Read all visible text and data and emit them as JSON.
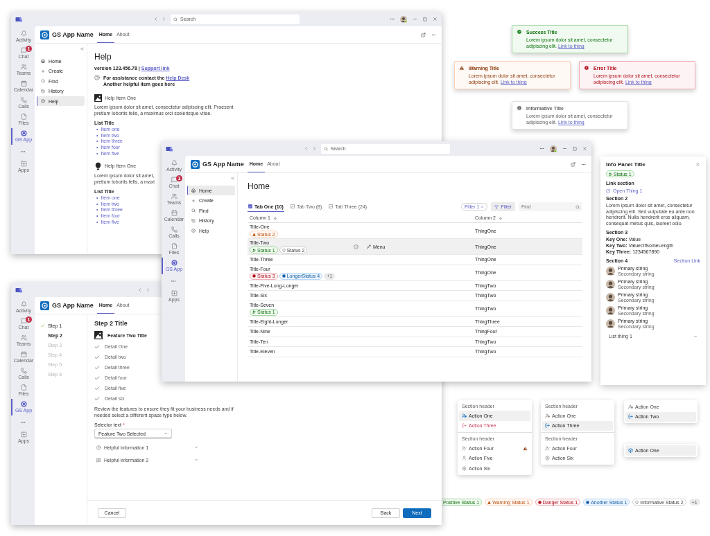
{
  "help_window": {
    "title_bar": {
      "search_placeholder": "Search"
    },
    "rail": [
      {
        "kind": "app",
        "label": "Activity",
        "selected": false
      },
      {
        "kind": "app",
        "label": "Chat",
        "selected": false,
        "badge": "1"
      },
      {
        "kind": "app",
        "label": "Teams",
        "selected": false
      },
      {
        "kind": "app",
        "label": "Calendar",
        "selected": false
      },
      {
        "kind": "app",
        "label": "Calls",
        "selected": false
      },
      {
        "kind": "app",
        "label": "Files",
        "selected": false
      },
      {
        "kind": "app",
        "label": "GS App",
        "selected": true
      },
      {
        "kind": "more"
      },
      {
        "kind": "app",
        "label": "Apps",
        "selected": false
      }
    ],
    "app_name": "GS App Name",
    "tabs": [
      {
        "label": "Home",
        "selected": true
      },
      {
        "label": "About",
        "selected": false
      }
    ],
    "nav": [
      {
        "label": "Home",
        "selected": false
      },
      {
        "label": "Create",
        "selected": false
      },
      {
        "label": "Find",
        "selected": false
      },
      {
        "label": "History",
        "selected": false
      },
      {
        "label": "Help",
        "selected": true
      }
    ],
    "page_title": "Help",
    "version": "version 123.456.78 | ",
    "support_link": "Support link",
    "assistance": "For assistance contact the ",
    "help_desk_link": "Help Desk",
    "assistance_note": "Another helpful item goes here",
    "help_items": [
      {
        "title": "Help Item One",
        "lines": [
          "Lorem ipsum dolor sit amet, consectetur adipiscing elit. Praesent",
          "pretium lobortis felis, a maximus orci scelerisque vitae."
        ],
        "list_title": "List Title",
        "marker": "•",
        "list": [
          "Item one",
          "Item two",
          "Item three",
          "Item four",
          "Item five"
        ]
      },
      {
        "title": "Help Item One",
        "lines": [
          "Lorem ipsum dolor sit amet,",
          "pretium lobortis felis, a maxi"
        ],
        "list_title": "List Title",
        "marker": "•",
        "list": [
          "Item one",
          "Item two",
          "Item three",
          "Item four",
          "Item five"
        ]
      }
    ]
  },
  "home_window": {
    "title_bar": {
      "search_placeholder": "Search"
    },
    "rail": [
      {
        "kind": "app",
        "label": "Activity",
        "selected": false
      },
      {
        "kind": "app",
        "label": "Chat",
        "selected": false,
        "badge": "1"
      },
      {
        "kind": "app",
        "label": "Teams",
        "selected": false
      },
      {
        "kind": "app",
        "label": "Calendar",
        "selected": false
      },
      {
        "kind": "app",
        "label": "Calls",
        "selected": false
      },
      {
        "kind": "app",
        "label": "Files",
        "selected": false
      },
      {
        "kind": "app",
        "label": "GS App",
        "selected": true
      },
      {
        "kind": "more"
      },
      {
        "kind": "app",
        "label": "Apps",
        "selected": false
      }
    ],
    "app_name": "GS App Name",
    "tabs": [
      {
        "label": "Home",
        "selected": true
      },
      {
        "label": "About",
        "selected": false
      }
    ],
    "nav": [
      {
        "label": "Home",
        "selected": true
      },
      {
        "label": "Create",
        "selected": false
      },
      {
        "label": "Find",
        "selected": false
      },
      {
        "label": "History",
        "selected": false
      },
      {
        "label": "Help",
        "selected": false
      }
    ],
    "page_title": "Home",
    "view_tabs": [
      {
        "label": "Tab One (10)",
        "selected": true
      },
      {
        "label": "Tab Two (8)",
        "selected": false
      },
      {
        "label": "Tab Three (24)",
        "selected": false
      }
    ],
    "filter_chip": "Filter 1",
    "filter_button": "Filter",
    "find_placeholder": "Find",
    "columns": [
      "Column 1",
      "Column 2"
    ],
    "rows": [
      {
        "title": "Title-One",
        "badges": [
          {
            "kind": "warning",
            "label": "Status 2"
          }
        ],
        "column_2": "ThingOne",
        "selected": false
      },
      {
        "title": "Title-Two",
        "badges": [
          {
            "kind": "positive",
            "label": "Status 1"
          },
          {
            "kind": "informative",
            "label": "Status 2"
          }
        ],
        "column_2": "ThingOne",
        "selected": true,
        "menu_label": "Menu"
      },
      {
        "title": "Title-Three",
        "badges": [],
        "column_2": "ThingOne",
        "selected": false
      },
      {
        "title": "Title-Four",
        "badges": [
          {
            "kind": "danger",
            "label": "Status 3"
          },
          {
            "kind": "brand",
            "label": "LongerStatus 4"
          },
          {
            "kind": "count",
            "label": "+1"
          }
        ],
        "column_2": "ThingOne",
        "selected": false
      },
      {
        "title": "Title-Five-Long-Longer",
        "badges": [],
        "column_2": "ThingTwo",
        "selected": false
      },
      {
        "title": "Title-Six",
        "badges": [],
        "column_2": "ThingTwo",
        "selected": false
      },
      {
        "title": "Title-Seven",
        "badges": [
          {
            "kind": "positive",
            "label": "Status 1"
          }
        ],
        "column_2": "ThingTwo",
        "selected": false
      },
      {
        "title": "Title-Eight-Longer",
        "badges": [],
        "column_2": "ThingThree",
        "selected": false
      },
      {
        "title": "Title-Nine",
        "badges": [],
        "column_2": "ThingFour",
        "selected": false
      },
      {
        "title": "Title-Ten",
        "badges": [],
        "column_2": "ThingTwo",
        "selected": false
      },
      {
        "title": "Title-Eleven",
        "badges": [],
        "column_2": "ThingTwo",
        "selected": false
      }
    ]
  },
  "wizard_window": {
    "rail": [
      {
        "kind": "app",
        "label": "Activity",
        "selected": false
      },
      {
        "kind": "app",
        "label": "Chat",
        "selected": false,
        "badge": "1"
      },
      {
        "kind": "app",
        "label": "Teams",
        "selected": false
      },
      {
        "kind": "app",
        "label": "Calendar",
        "selected": false
      },
      {
        "kind": "app",
        "label": "Calls",
        "selected": false
      },
      {
        "kind": "app",
        "label": "Files",
        "selected": false
      },
      {
        "kind": "app",
        "label": "GS App",
        "selected": true
      },
      {
        "kind": "more"
      },
      {
        "kind": "app",
        "label": "Apps",
        "selected": false
      }
    ],
    "app_name": "GS App Name",
    "tabs": [
      {
        "label": "Home",
        "selected": true
      },
      {
        "label": "About",
        "selected": false
      }
    ],
    "steps": [
      {
        "label": "Step 1",
        "completed": true,
        "selected": false,
        "disabled": false
      },
      {
        "label": "Step 2",
        "completed": false,
        "selected": true,
        "disabled": false
      },
      {
        "label": "Step 3",
        "completed": false,
        "selected": false,
        "disabled": true
      },
      {
        "label": "Step 4",
        "completed": false,
        "selected": false,
        "disabled": true
      },
      {
        "label": "Step 5",
        "completed": false,
        "selected": false,
        "disabled": true
      },
      {
        "label": "Step 6",
        "completed": false,
        "selected": false,
        "disabled": true
      }
    ],
    "step_title": "Step 2 Title",
    "feature_title": "Feature Two Title",
    "details": [
      "Detail One",
      "Detail two",
      "Detail three",
      "Detail four",
      "Detail five",
      "Detail six"
    ],
    "review_lines": [
      "Review the features to ensure they fit your business needs and if",
      "needed select a different space type below."
    ],
    "selector_label": "Selector text",
    "required_mark": "*",
    "selector_value": "Feature Two Selected",
    "accordions": [
      {
        "label": "Helpful information 1",
        "expanded": false
      },
      {
        "label": "Helpful information 2",
        "expanded": false
      }
    ],
    "buttons": [
      {
        "label": "Cancel",
        "kind": "secondary"
      },
      {
        "label": "Back",
        "kind": "secondary"
      },
      {
        "label": "Next",
        "kind": "primary"
      }
    ]
  },
  "toasts": [
    {
      "kind": "success",
      "title": "Success Title",
      "text": "Lorem ipsum dolor sit amet, consectetur adipiscing elit.",
      "link": "Link to thing"
    },
    {
      "kind": "warning",
      "title": "Warning Title",
      "text": "Lorem ipsum dolor sit amet, consectetur adipiscing elit.",
      "link": "Link to thing"
    },
    {
      "kind": "error",
      "title": "Error Title",
      "text": "Lorem ipsum dolor sit amet, consectetur adipiscing elit.",
      "link": "Link to thing"
    },
    {
      "kind": "info",
      "title": "Informative Title",
      "text": "Lorem ipsum dolor sit amet, consectetur adipiscing elit.",
      "link": "Link to thing"
    }
  ],
  "info_panel": {
    "title": "Info Panel Title",
    "status": {
      "kind": "positive",
      "label": "Status 1"
    },
    "link_section": "Link section",
    "link": "Open Thing 1",
    "section_2": "Section 2",
    "paragraph": "Lorem ipsum dolor sit amet, consectetur adipiscing elit. Sed vulputate eu ante non hendrerit. Nulla hendrerit eros aliquam, consequat metus quis, laoreet odio.",
    "section_3": "Section 3",
    "pairs": [
      {
        "key": "Key One:",
        "value": "Value"
      },
      {
        "key": "Key Two:",
        "value": "ValueOfSomeLength"
      },
      {
        "key": "Key Three:",
        "value": "1234567890"
      }
    ],
    "section_4": "Section 4",
    "section_link": "Section Link",
    "people": [
      {
        "primary": "Primary string",
        "secondary": "Secondary string"
      },
      {
        "primary": "Primary string",
        "secondary": "Secondary string"
      },
      {
        "primary": "Primary string",
        "secondary": "Secondary string"
      },
      {
        "primary": "Primary string",
        "secondary": "Secondary string"
      },
      {
        "primary": "Primary string",
        "secondary": "Secondary string"
      }
    ],
    "list_item": {
      "label": "List thing 1",
      "expanded": false
    }
  },
  "menus": [
    {
      "items": [
        {
          "kind": "header",
          "label": "Section header"
        },
        {
          "kind": "action",
          "label": "Action One",
          "selected": true,
          "alert": false
        },
        {
          "kind": "danger",
          "label": "Action Three",
          "selected": false,
          "alert": false
        },
        {
          "kind": "divider"
        },
        {
          "kind": "header",
          "label": "Section header"
        },
        {
          "kind": "action",
          "label": "Action Four",
          "selected": false,
          "alert": true
        },
        {
          "kind": "action",
          "label": "Action Five",
          "selected": false,
          "alert": false
        },
        {
          "kind": "action",
          "label": "Action Six",
          "selected": false,
          "alert": false
        }
      ]
    },
    {
      "items": [
        {
          "kind": "header",
          "label": "Section header"
        },
        {
          "kind": "action",
          "label": "Action One",
          "selected": false,
          "alert": false
        },
        {
          "kind": "action",
          "label": "Action Three",
          "selected": true,
          "alert": false
        },
        {
          "kind": "divider"
        },
        {
          "kind": "header",
          "label": "Section header"
        },
        {
          "kind": "action",
          "label": "Action Four",
          "selected": false,
          "alert": false
        },
        {
          "kind": "action",
          "label": "Action Six",
          "selected": false,
          "alert": false
        }
      ]
    },
    {
      "items": [
        {
          "kind": "action",
          "label": "Action One",
          "selected": false,
          "alert": false
        },
        {
          "kind": "action",
          "label": "Action Two",
          "selected": true,
          "alert": false
        }
      ]
    },
    {
      "items": [
        {
          "kind": "action",
          "label": "Action One",
          "selected": true,
          "alert": false
        }
      ]
    }
  ],
  "status_badges": [
    {
      "kind": "positive",
      "label": "Positive Status 1"
    },
    {
      "kind": "warning",
      "label": "Warning Status 1"
    },
    {
      "kind": "danger",
      "label": "Danger Status 1"
    },
    {
      "kind": "brand",
      "label": "Another Status 1"
    },
    {
      "kind": "informative",
      "label": "Informative Status 2"
    },
    {
      "kind": "count",
      "label": "+1"
    }
  ]
}
